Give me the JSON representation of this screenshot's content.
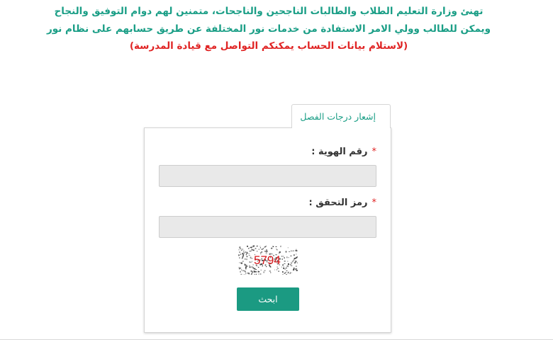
{
  "announcement": {
    "line1": "تهنئ وزارة التعليم الطلاب والطالبات الناجحين والناجحات، متمنين لهم دوام التوفيق والنجاح",
    "line2": "ويمكن للطالب وولي الامر الاستفادة من خدمات نور المختلفة عن طريق حسابهم على نظام نور",
    "line3": "(لاستلام بيانات الحساب يمكنكم التواصل مع قيادة المدرسة)",
    "primary_color": "#1a9e86",
    "alert_color": "#e02424"
  },
  "tab": {
    "label": "إشعار درجات الفصل"
  },
  "form": {
    "id_field": {
      "required_mark": "*",
      "label": "رقم الهوية :",
      "value": "",
      "placeholder": ""
    },
    "code_field": {
      "required_mark": "*",
      "label": "رمز التحقق :",
      "value": "",
      "placeholder": ""
    },
    "captcha": {
      "text": "5794",
      "text_color": "#d8181c"
    },
    "submit_label": "ابحث",
    "button_color": "#1b9a82"
  }
}
